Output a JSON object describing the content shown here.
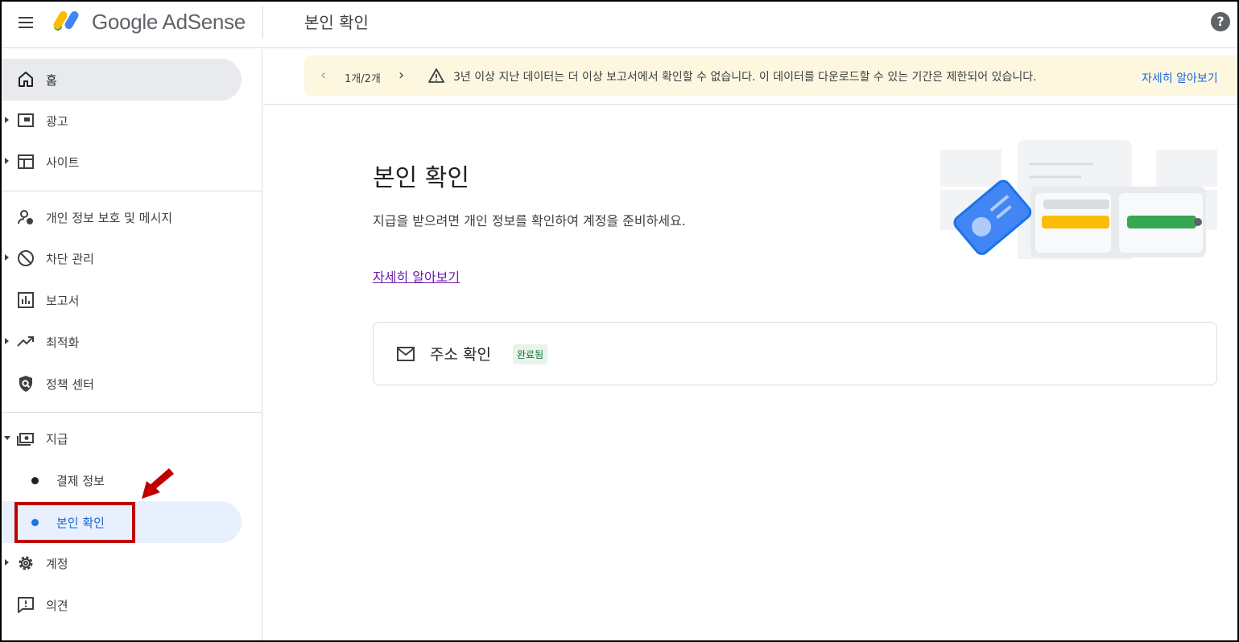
{
  "app": {
    "brand": "Google AdSense",
    "page_title": "본인 확인",
    "help_label": "?"
  },
  "sidebar": {
    "items": [
      {
        "label": "홈"
      },
      {
        "label": "광고"
      },
      {
        "label": "사이트"
      },
      {
        "label": "개인 정보 보호 및 메시지"
      },
      {
        "label": "차단 관리"
      },
      {
        "label": "보고서"
      },
      {
        "label": "최적화"
      },
      {
        "label": "정책 센터"
      },
      {
        "label": "지급",
        "sub_items": [
          {
            "label": "결제 정보"
          },
          {
            "label": "본인 확인"
          }
        ]
      },
      {
        "label": "계정"
      },
      {
        "label": "의견"
      }
    ]
  },
  "banner": {
    "pager": "1개/2개",
    "message": "3년 이상 지난 데이터는 더 이상 보고서에서 확인할 수 없습니다. 이 데이터를 다운로드할 수 있는 기간은 제한되어 있습니다.",
    "learn_more": "자세히 알아보기",
    "background_color": "#fef7e0"
  },
  "main": {
    "title": "본인 확인",
    "description": "지급을 받으려면 개인 정보를 확인하여 계정을 준비하세요.",
    "learn_more": "자세히 알아보기",
    "card": {
      "title": "주소 확인",
      "status": "완료됨"
    }
  },
  "colors": {
    "accent": "#1a73e8",
    "active_bg": "#e8f0fe",
    "annotation_red": "#c00000",
    "success": "#137333"
  }
}
